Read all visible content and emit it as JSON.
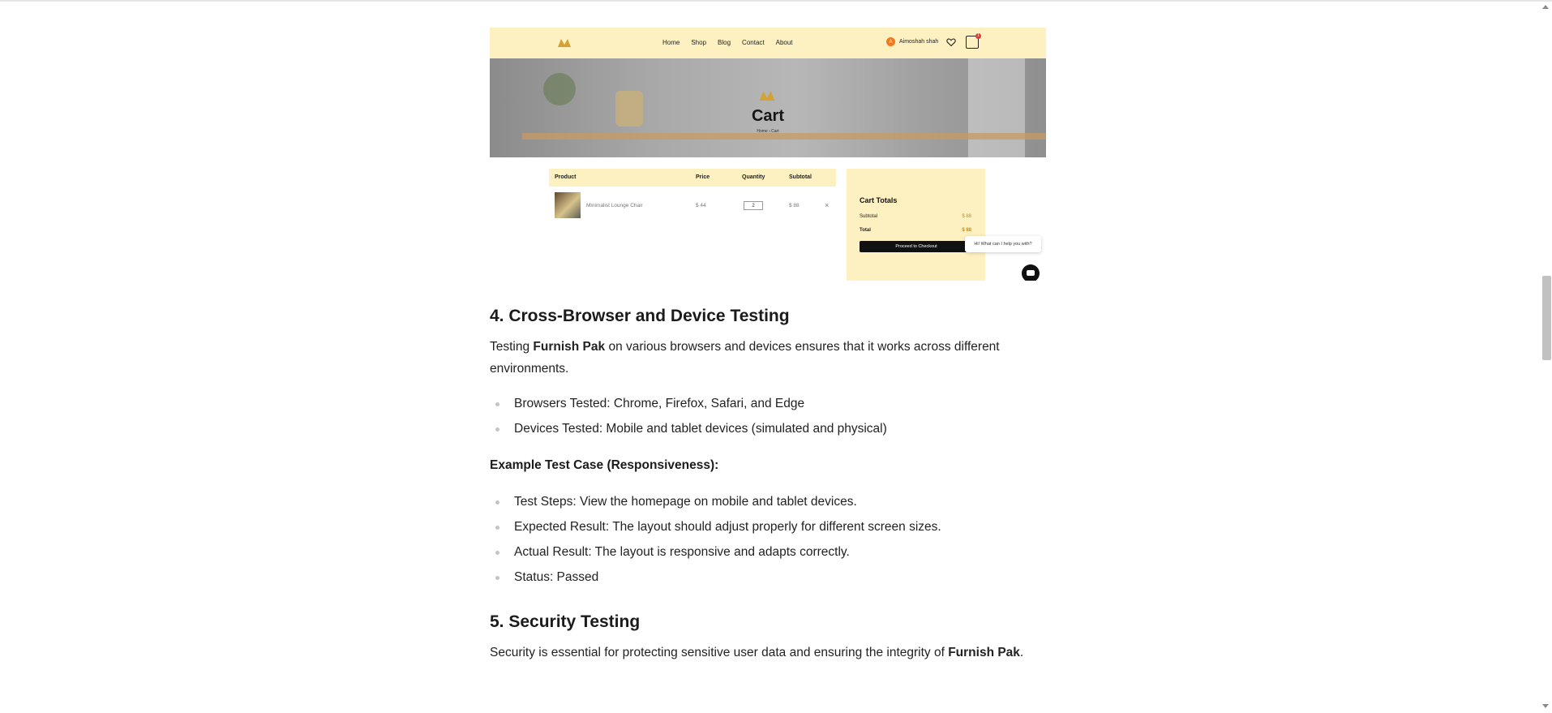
{
  "embedded": {
    "nav": {
      "items": [
        "Home",
        "Shop",
        "Blog",
        "Contact",
        "About"
      ],
      "user_initial": "A",
      "user_name": "Aimoshah shah",
      "cart_count": "1"
    },
    "hero": {
      "title": "Cart",
      "breadcrumb": "Home  ›  Cart"
    },
    "cart_table": {
      "headers": [
        "Product",
        "Price",
        "Quantity",
        "Subtotal"
      ],
      "rows": [
        {
          "product": "Minimalist Lounge Chair",
          "price": "$ 44",
          "quantity": "2",
          "subtotal": "$ 88",
          "remove": "×"
        }
      ]
    },
    "totals": {
      "title": "Cart Totals",
      "subtotal_label": "Subtotal",
      "subtotal_value": "$ 88",
      "total_label": "Total",
      "total_value": "$ 88",
      "checkout_label": "Proceed to Checkout"
    },
    "chat": {
      "prompt": "Hi! What can I help you with?"
    },
    "colors": {
      "nav_bg": "#fdf1c2",
      "accent": "#c98a1c",
      "avatar": "#f07a1a"
    }
  },
  "section4": {
    "heading": "4. Cross-Browser and Device Testing",
    "intro_pre": "Testing ",
    "intro_bold": "Furnish Pak",
    "intro_post": " on various browsers and devices ensures that it works across different environments.",
    "bullets": [
      "Browsers Tested: Chrome, Firefox, Safari, and Edge",
      "Devices Tested: Mobile and tablet devices (simulated and physical)"
    ],
    "example_title": "Example Test Case (Responsiveness):",
    "example_bullets": [
      "Test Steps: View the homepage on mobile and tablet devices.",
      "Expected Result: The layout should adjust properly for different screen sizes.",
      "Actual Result: The layout is responsive and adapts correctly.",
      "Status: Passed"
    ]
  },
  "section5": {
    "heading": "5. Security Testing",
    "intro_pre": "Security is essential for protecting sensitive user data and ensuring the integrity of ",
    "intro_bold": "Furnish Pak",
    "intro_post": "."
  }
}
